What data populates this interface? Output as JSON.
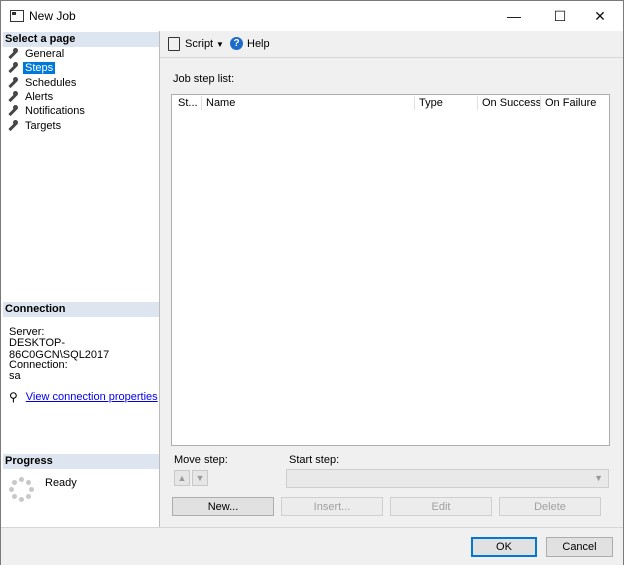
{
  "window": {
    "title": "New Job",
    "icon": "job-window-icon",
    "minimize_glyph": "—",
    "maximize_glyph": "☐",
    "close_glyph": "✕"
  },
  "select_page": {
    "header": "Select a page",
    "items": [
      {
        "label": "General",
        "icon": "wrench-icon",
        "selected": false
      },
      {
        "label": "Steps",
        "icon": "wrench-icon",
        "selected": true
      },
      {
        "label": "Schedules",
        "icon": "wrench-icon",
        "selected": false
      },
      {
        "label": "Alerts",
        "icon": "wrench-icon",
        "selected": false
      },
      {
        "label": "Notifications",
        "icon": "wrench-icon",
        "selected": false
      },
      {
        "label": "Targets",
        "icon": "wrench-icon",
        "selected": false
      }
    ]
  },
  "connection": {
    "header": "Connection",
    "server_label": "Server:",
    "server_value": "DESKTOP-86C0GCN\\SQL2017",
    "connection_label": "Connection:",
    "connection_value": "sa",
    "link_label": "View connection properties"
  },
  "progress": {
    "header": "Progress",
    "status": "Ready"
  },
  "toolbar": {
    "script_label": "Script",
    "script_dropdown_glyph": "▼",
    "help_label": "Help",
    "help_glyph": "?"
  },
  "job_steps": {
    "list_label": "Job step list:",
    "columns": [
      "St...",
      "Name",
      "Type",
      "On Success",
      "On Failure"
    ],
    "rows": []
  },
  "move_step": {
    "label": "Move step:",
    "up_glyph": "▲",
    "down_glyph": "▼"
  },
  "start_step": {
    "label": "Start step:",
    "value": "",
    "dropdown_glyph": "▼"
  },
  "actions": {
    "new_label": "New...",
    "insert_label": "Insert...",
    "edit_label": "Edit",
    "delete_label": "Delete"
  },
  "dialog_buttons": {
    "ok_label": "OK",
    "cancel_label": "Cancel"
  },
  "colors": {
    "accent": "#0078d7",
    "section_header_bg": "#dde6f0",
    "link": "#0000ee"
  }
}
